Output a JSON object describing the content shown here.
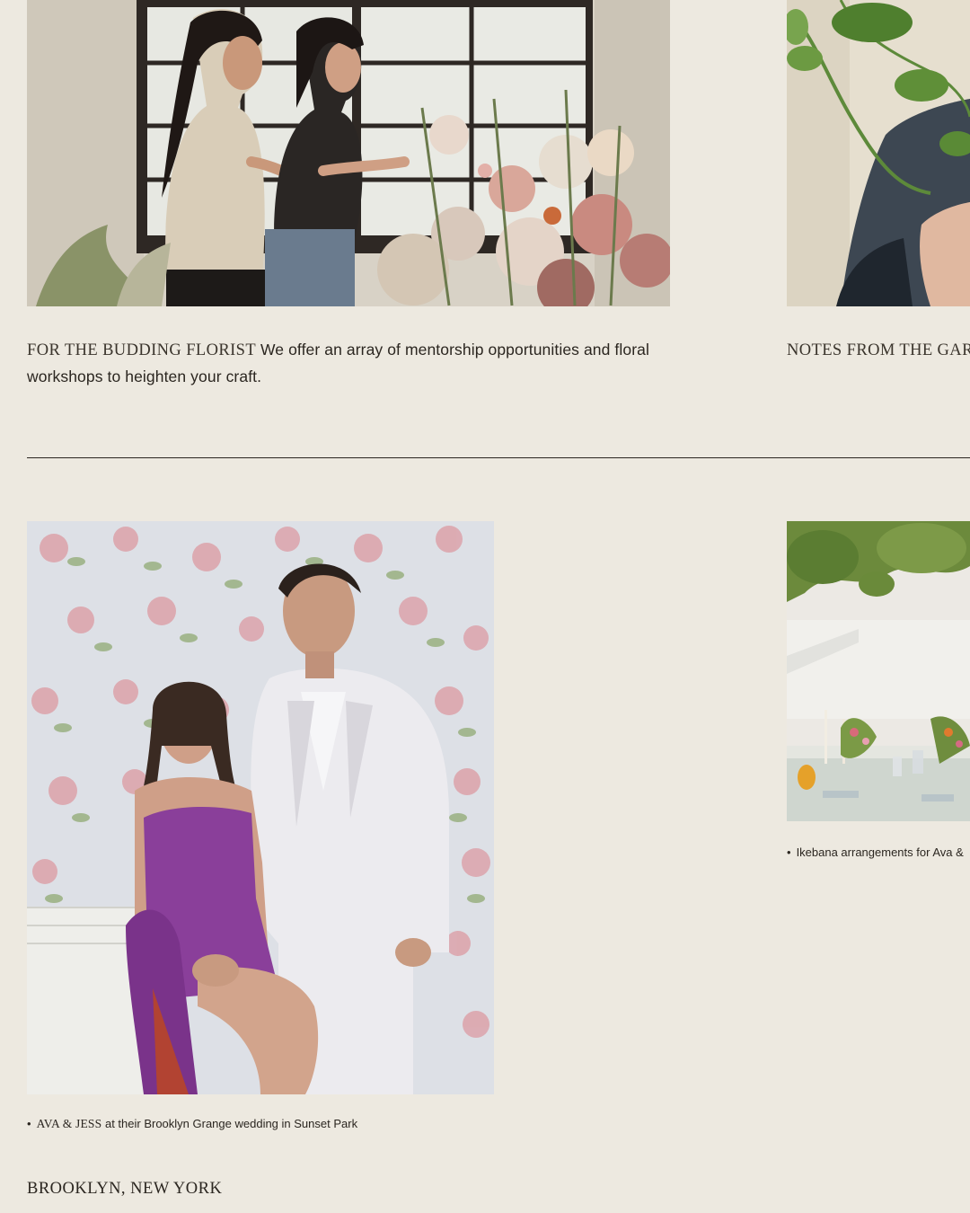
{
  "workshop_feature": {
    "heading": "FOR THE BUDDING FLORIST",
    "body": " We offer an array of mentorship opportunities and floral workshops to heighten your craft."
  },
  "garden_feature": {
    "heading": "NOTES FROM THE GAR"
  },
  "wedding_caption": {
    "bullet": "•",
    "names": "AVA & JESS",
    "text": " at their Brooklyn Grange wedding in Sunset Park"
  },
  "ikebana_caption": {
    "bullet": "•",
    "text": "Ikebana arrangements for Ava &"
  },
  "location": {
    "label": "BROOKLYN, NEW YORK"
  },
  "colors": {
    "background": "#ede9e0",
    "text": "#2b2620",
    "divider": "#2b2620"
  }
}
